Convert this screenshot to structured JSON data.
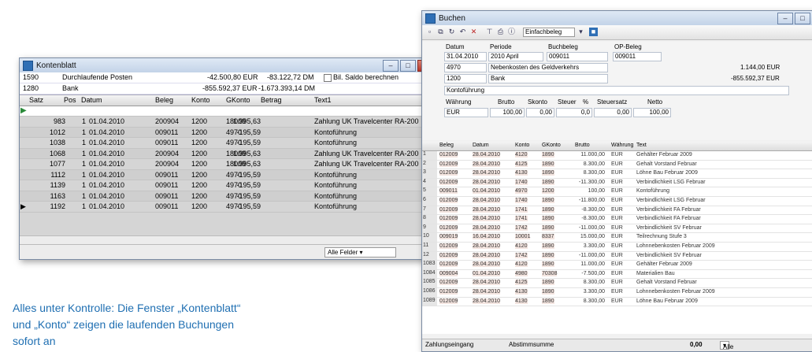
{
  "kontenblatt": {
    "title": "Kontenblatt",
    "info_rows": [
      {
        "acct": "1590",
        "name": "Durchlaufende Posten",
        "v1": "-42.500,80 EUR",
        "v2": "-83.122,72 DM",
        "chk": "Bil. Saldo berechnen"
      },
      {
        "acct": "1280",
        "name": "Bank",
        "v1": "-855.592,37 EUR",
        "v2": "-1.673.393,14 DM",
        "chk": ""
      }
    ],
    "headers": [
      "Satz",
      "Pos",
      "Datum",
      "Beleg",
      "Konto",
      "GKonto",
      "Betrag",
      "Text1"
    ],
    "rows": [
      [
        "983",
        "1",
        "01.04.2010",
        "200904",
        "1200",
        "18009",
        "1.995,63",
        "Zahlung UK Travelcenter RA-200"
      ],
      [
        "1012",
        "1",
        "01.04.2010",
        "009011",
        "1200",
        "4970",
        "-195,59",
        "Kontoführung"
      ],
      [
        "1038",
        "1",
        "01.04.2010",
        "009011",
        "1200",
        "4970",
        "-195,59",
        "Kontoführung"
      ],
      [
        "1068",
        "1",
        "01.04.2010",
        "200904",
        "1200",
        "18009",
        "1.995,63",
        "Zahlung UK Travelcenter RA-200"
      ],
      [
        "1077",
        "1",
        "01.04.2010",
        "200904",
        "1200",
        "18009",
        "1.995,63",
        "Zahlung UK Travelcenter RA-200"
      ],
      [
        "1112",
        "1",
        "01.04.2010",
        "009011",
        "1200",
        "4970",
        "-195,59",
        "Kontoführung"
      ],
      [
        "1139",
        "1",
        "01.04.2010",
        "009011",
        "1200",
        "4970",
        "-195,59",
        "Kontoführung"
      ],
      [
        "1163",
        "1",
        "01.04.2010",
        "009011",
        "1200",
        "4970",
        "-195,59",
        "Kontoführung"
      ],
      [
        "1192",
        "1",
        "01.04.2010",
        "009011",
        "1200",
        "4970",
        "-195,59",
        "Kontoführung"
      ]
    ],
    "status_combo": "Alle Felder"
  },
  "buchen": {
    "title": "Buchen",
    "toolbar_combo": "Einfachbeleg",
    "form": {
      "lbl_datum": "Datum",
      "lbl_periode": "Periode",
      "lbl_buchbeleg": "Buchbeleg",
      "lbl_opbeleg": "OP-Beleg",
      "datum": "31.04.2010",
      "periode": "2010 April",
      "buchbeleg": "009011",
      "opbeleg": "009011",
      "konto": "4970",
      "konto_name": "Nebenkosten des Geldverkehrs",
      "konto_saldo": "1.144,00 EUR",
      "gkonto": "1200",
      "gkonto_name": "Bank",
      "gkonto_saldo": "-855.592,37 EUR",
      "text": "Kontoführung",
      "lbl_waehrung": "Währung",
      "lbl_brutto": "Brutto",
      "lbl_skonto": "Skonto",
      "lbl_steuer": "Steuer",
      "lbl_pct": "%",
      "lbl_steuersatz": "Steuersatz",
      "lbl_netto": "Netto",
      "waehrung": "EUR",
      "brutto": "100,00",
      "skonto": "0,00",
      "steuer": "0,0",
      "steuersatz": "0,00",
      "netto": "100,00"
    },
    "headers": [
      "Beleg",
      "Datum",
      "Konto",
      "GKonto",
      "Brutto",
      "Währung",
      "Text"
    ],
    "rows": [
      [
        "012009",
        "28.04.2010",
        "4120",
        "1890",
        "11.000,00",
        "EUR",
        "Gehälter Februar 2009"
      ],
      [
        "012009",
        "28.04.2010",
        "4125",
        "1890",
        "8.300,00",
        "EUR",
        "Gehalt Vorstand Februar"
      ],
      [
        "012009",
        "28.04.2010",
        "4130",
        "1890",
        "8.300,00",
        "EUR",
        "Löhne Bau Februar 2009"
      ],
      [
        "012009",
        "28.04.2010",
        "1740",
        "1890",
        "-11.300,00",
        "EUR",
        "Verbindlichkeit LSG Februar"
      ],
      [
        "009011",
        "01.04.2010",
        "4970",
        "1200",
        "100,00",
        "EUR",
        "Kontoführung"
      ],
      [
        "012009",
        "28.04.2010",
        "1740",
        "1890",
        "-11.800,00",
        "EUR",
        "Verbindlichkeit LSG Februar"
      ],
      [
        "012009",
        "28.04.2010",
        "1741",
        "1890",
        "-8.300,00",
        "EUR",
        "Verbindlichkeit FA Februar"
      ],
      [
        "012009",
        "28.04.2010",
        "1741",
        "1890",
        "-8.300,00",
        "EUR",
        "Verbindlichkeit FA Februar"
      ],
      [
        "012009",
        "28.04.2010",
        "1742",
        "1890",
        "-11.000,00",
        "EUR",
        "Verbindlichkeit SV Februar"
      ],
      [
        "009019",
        "16.04.2010",
        "10001",
        "8337",
        "15.000,00",
        "EUR",
        "Teilrechnung Stufe 3"
      ],
      [
        "012009",
        "28.04.2010",
        "4120",
        "1890",
        "3.300,00",
        "EUR",
        "Lohnnebenkosten Februar 2009"
      ],
      [
        "012009",
        "28.04.2010",
        "1742",
        "1890",
        "-11.000,00",
        "EUR",
        "Verbindlichkeit SV Februar"
      ],
      [
        "012009",
        "28.04.2010",
        "4120",
        "1890",
        "11.000,00",
        "EUR",
        "Gehälter Februar 2009"
      ],
      [
        "009004",
        "01.04.2010",
        "4980",
        "70308",
        "-7.500,00",
        "EUR",
        "Materialien Bau"
      ],
      [
        "012009",
        "28.04.2010",
        "4125",
        "1890",
        "8.300,00",
        "EUR",
        "Gehalt Vorstand Februar"
      ],
      [
        "012009",
        "28.04.2010",
        "4130",
        "1890",
        "3.300,00",
        "EUR",
        "Lohnnebenkosten Februar 2009"
      ],
      [
        "012009",
        "28.04.2010",
        "4130",
        "1890",
        "8.300,00",
        "EUR",
        "Löhne Bau Februar 2009"
      ]
    ],
    "row_numbers": [
      "1",
      "2",
      "3",
      "4",
      "5",
      "6",
      "7",
      "8",
      "9",
      "10",
      "11",
      "12",
      "1083",
      "1084",
      "1085",
      "1086",
      "1089"
    ],
    "status_left": "Zahlungseingang",
    "status_mid": "Abstimmsumme",
    "status_sum": "0,00",
    "status_combo": "Alle Felder"
  },
  "caption": "Alles unter Kontrolle: Die Fenster „Kontenblatt“ und „Konto“ zeigen die laufenden Buchungen sofort an"
}
